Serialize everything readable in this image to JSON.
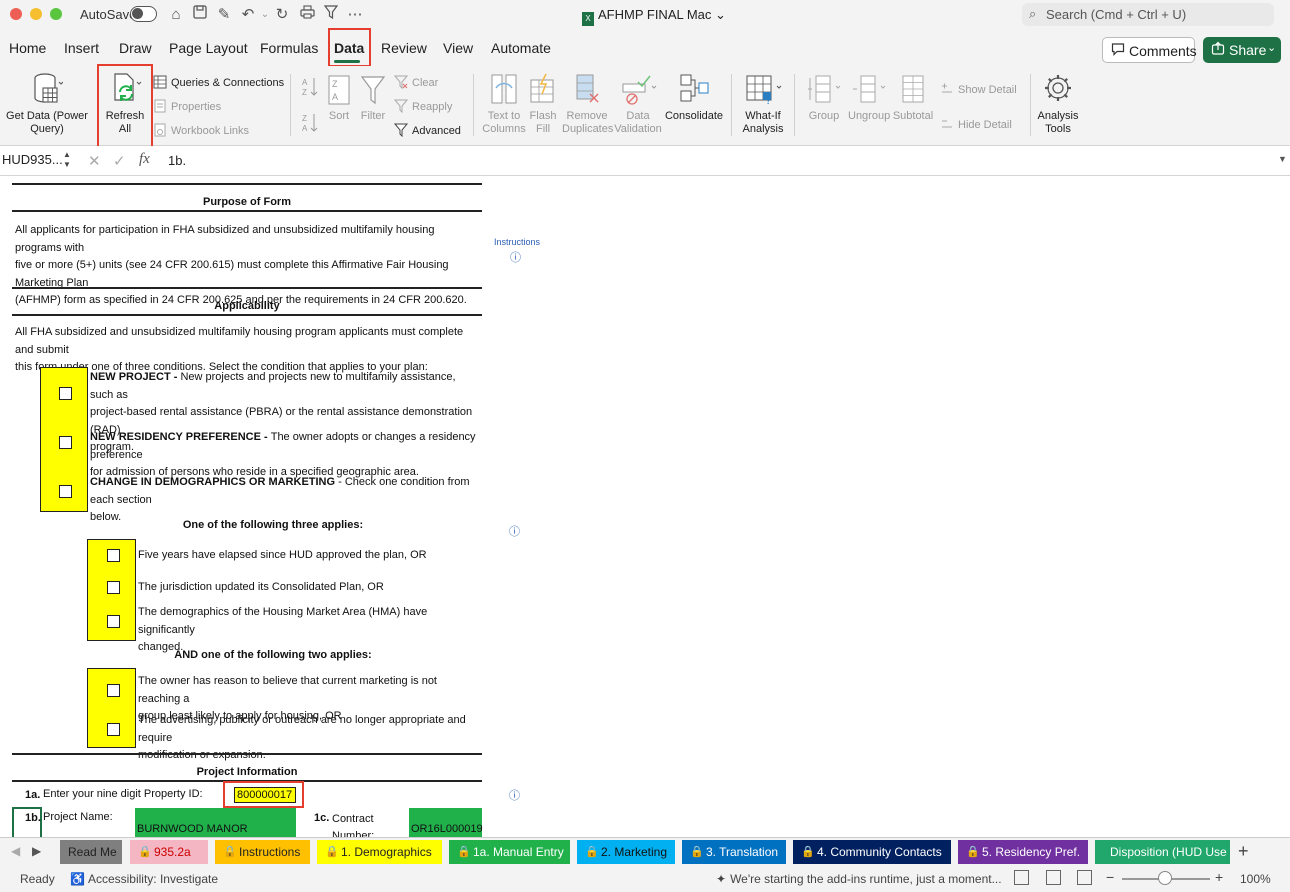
{
  "window": {
    "autosave_label": "AutoSave",
    "title": "AFHMP FINAL Mac",
    "title_chevron": "⌄",
    "search_placeholder": "Search (Cmd + Ctrl + U)"
  },
  "ribbon_tabs": [
    "Home",
    "Insert",
    "Draw",
    "Page Layout",
    "Formulas",
    "Data",
    "Review",
    "View",
    "Automate"
  ],
  "active_tab": "Data",
  "header_buttons": {
    "comments": "Comments",
    "share": "Share"
  },
  "ribbon": {
    "get_data": "Get Data (Power Query)",
    "refresh_all": "Refresh All",
    "queries_connections": "Queries & Connections",
    "properties": "Properties",
    "workbook_links": "Workbook Links",
    "sort": "Sort",
    "filter": "Filter",
    "clear": "Clear",
    "reapply": "Reapply",
    "advanced": "Advanced",
    "text_to_columns": "Text to Columns",
    "flash_fill": "Flash Fill",
    "remove_duplicates": "Remove Duplicates",
    "data_validation": "Data Validation",
    "consolidate": "Consolidate",
    "what_if": "What-If Analysis",
    "group": "Group",
    "ungroup": "Ungroup",
    "subtotal": "Subtotal",
    "show_detail": "Show Detail",
    "hide_detail": "Hide Detail",
    "analysis_tools": "Analysis Tools"
  },
  "formula_bar": {
    "name_box": "HUD935...",
    "value": "1b."
  },
  "sheet": {
    "purpose_title": "Purpose of Form",
    "purpose_lines": [
      "All applicants for participation in FHA subsidized and unsubsidized multifamily housing programs with",
      "five or more (5+) units (see 24 CFR 200.615) must complete this Affirmative Fair Housing Marketing Plan",
      "(AFHMP) form as specified in 24 CFR 200.625 and per the requirements in 24 CFR 200.620."
    ],
    "instructions_link": "Instructions",
    "applicability_title": "Applicability",
    "applicability_lines": [
      "All FHA subsidized and unsubsidized multifamily housing program applicants must complete and submit",
      "this form under one of three conditions. Select the condition that applies to your plan:"
    ],
    "conditions": [
      {
        "bold": "NEW PROJECT - ",
        "line1": "New projects and projects new to multifamily assistance, such as",
        "line2": "project-based rental assistance (PBRA) or the rental assistance demonstration (RAD)",
        "line3": "program."
      },
      {
        "bold": "NEW RESIDENCY PREFERENCE - ",
        "line1": "The owner adopts or changes a residency preference",
        "line2": "for admission of persons who reside in a specified geographic area."
      },
      {
        "bold": "CHANGE IN DEMOGRAPHICS OR MARKETING",
        "line1": " - Check one condition from each section",
        "line2": "below."
      }
    ],
    "three_applies_title": "One of the following three applies:",
    "three_applies": [
      {
        "line1": "Five years have elapsed since HUD approved the plan, OR"
      },
      {
        "line1": "The jurisdiction updated its Consolidated Plan, OR"
      },
      {
        "line1": "The demographics of the Housing Market Area (HMA) have significantly",
        "line2": "changed."
      }
    ],
    "two_applies_title": "AND one of the following two applies:",
    "two_applies": [
      {
        "line1": "The owner has reason to believe that current marketing is not reaching a",
        "line2": "group least likely to apply for housing, OR"
      },
      {
        "line1": "The advertising, publicity or outreach are no longer appropriate and require",
        "line2": "modification or expansion."
      }
    ],
    "project_info_title": "Project Information",
    "item_1a_num": "1a.",
    "item_1a_label": "Enter your nine digit Property ID:",
    "property_id": "800000017",
    "item_1b_num": "1b.",
    "item_1b_label": "Project Name:",
    "project_name": "BURNWOOD MANOR",
    "item_1c_num": "1c.",
    "item_1c_label": "Contract Number:",
    "contract_number": "OR16L000019"
  },
  "sheet_tabs": [
    {
      "label": "Read Me",
      "color": "#7f7f7f",
      "locked": false
    },
    {
      "label": "935.2a",
      "color": "#f4b6c2",
      "locked": true
    },
    {
      "label": "Instructions",
      "color": "#ffc000",
      "locked": true
    },
    {
      "label": "1. Demographics",
      "color": "#ffff00",
      "locked": true
    },
    {
      "label": "1a. Manual Entry",
      "color": "#21b14b",
      "locked": true
    },
    {
      "label": "2. Marketing",
      "color": "#00b0f0",
      "locked": true
    },
    {
      "label": "3. Translation",
      "color": "#0070c0",
      "locked": true
    },
    {
      "label": "4. Community Contacts",
      "color": "#002060",
      "locked": true
    },
    {
      "label": "5. Residency Pref.",
      "color": "#7030a0",
      "locked": true
    },
    {
      "label": "Disposition (HUD Use Only)",
      "color": "#21a76c",
      "locked": false
    }
  ],
  "statusbar": {
    "ready": "Ready",
    "accessibility": "Accessibility: Investigate",
    "message": "We're starting the add-ins runtime, just a moment...",
    "zoom": "100%"
  },
  "colors": {
    "accent": "#1e7145",
    "highlight": "#e53d2e",
    "yellow": "#ffff00",
    "green_cell": "#21b14b"
  }
}
